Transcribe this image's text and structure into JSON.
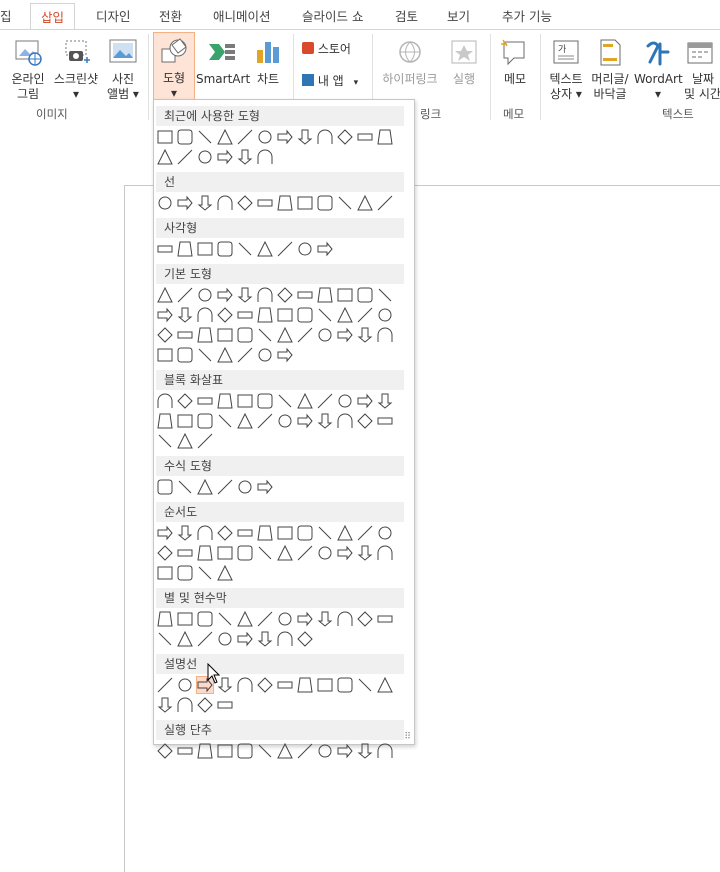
{
  "tabs": [
    "집",
    "삽입",
    "디자인",
    "전환",
    "애니메이션",
    "슬라이드 쇼",
    "검토",
    "보기",
    "추가 기능"
  ],
  "ribbon": {
    "online_pictures": [
      "온라인",
      "그림"
    ],
    "screenshot": [
      "스크린샷",
      "▾"
    ],
    "photo_album": [
      "사진",
      "앨범 ▾"
    ],
    "shapes": [
      "도형",
      "▾"
    ],
    "smartart": "SmartArt",
    "chart": "차트",
    "store": "스토어",
    "my_apps": "내 앱",
    "hyperlink": "하이퍼링크",
    "action": "실행",
    "comment": "메모",
    "textbox": [
      "텍스트",
      "상자 ▾"
    ],
    "header_footer": [
      "머리글/",
      "바닥글"
    ],
    "wordart": [
      "WordArt",
      "▾"
    ],
    "datetime": [
      "날짜",
      "및 시간"
    ],
    "groups": {
      "images": "이미지",
      "links": "링크",
      "comments": "메모",
      "text": "텍스트"
    }
  },
  "menu": {
    "sections": [
      {
        "title": "최근에 사용한 도형",
        "rows": 2,
        "counts": [
          12,
          6
        ]
      },
      {
        "title": "선",
        "rows": 1,
        "counts": [
          12
        ]
      },
      {
        "title": "사각형",
        "rows": 1,
        "counts": [
          9
        ]
      },
      {
        "title": "기본 도형",
        "rows": 4,
        "counts": [
          12,
          12,
          12,
          7
        ]
      },
      {
        "title": "블록 화살표",
        "rows": 3,
        "counts": [
          12,
          12,
          3
        ]
      },
      {
        "title": "수식 도형",
        "rows": 1,
        "counts": [
          6
        ]
      },
      {
        "title": "순서도",
        "rows": 3,
        "counts": [
          12,
          12,
          4
        ]
      },
      {
        "title": "별 및 현수막",
        "rows": 2,
        "counts": [
          12,
          8
        ]
      },
      {
        "title": "설명선",
        "rows": 2,
        "counts": [
          12,
          4
        ]
      },
      {
        "title": "실행 단추",
        "rows": 1,
        "counts": [
          12
        ]
      }
    ],
    "highlighted": "설명선: 타원형"
  },
  "colors": {
    "accent": "#d24726",
    "highlight": "#fcd9c8"
  }
}
